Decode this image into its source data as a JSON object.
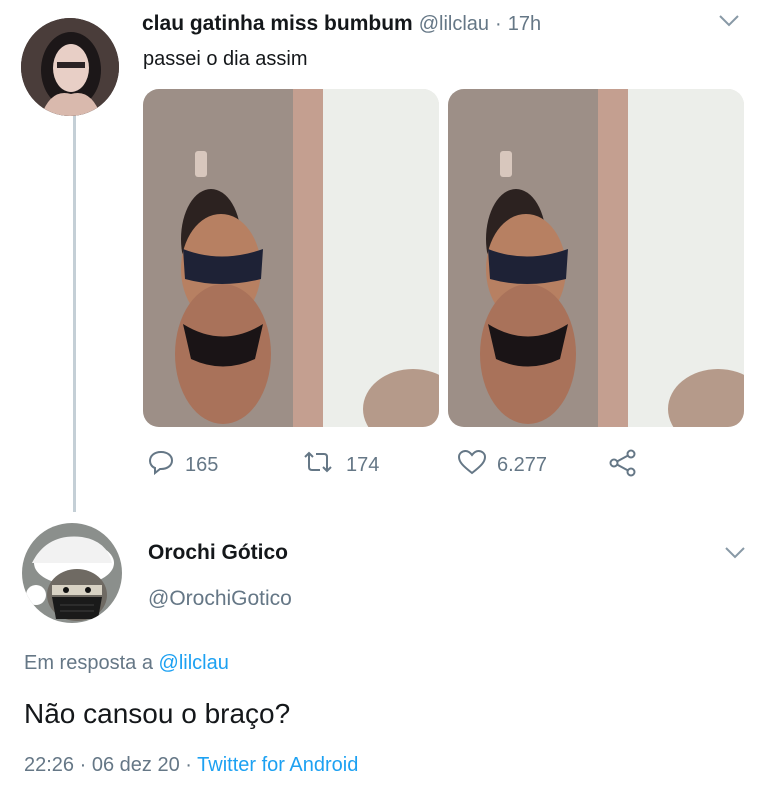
{
  "tweet": {
    "display_name": "clau gatinha miss bumbum",
    "handle": "@lilclau",
    "separator": "·",
    "time": "17h",
    "text": "passei o dia assim",
    "media_count": 2,
    "actions": {
      "replies": "165",
      "retweets": "174",
      "likes": "6.277"
    },
    "icons": {
      "menu": "chevron-down-icon",
      "reply": "comment-icon",
      "retweet": "retweet-icon",
      "like": "heart-icon",
      "share": "share-icon"
    }
  },
  "reply": {
    "display_name": "Orochi Gótico",
    "handle": "@OrochiGotico",
    "in_reply_to_prefix": "Em resposta a",
    "in_reply_to_handle": "@lilclau",
    "text": "Não cansou o braço?",
    "time": "22:26",
    "separator": "·",
    "date": "06 dez 20",
    "separator2": "·",
    "source": "Twitter for Android"
  },
  "colors": {
    "link": "#1da1f2",
    "muted": "#657786",
    "thread_line": "#c4cfd6"
  }
}
